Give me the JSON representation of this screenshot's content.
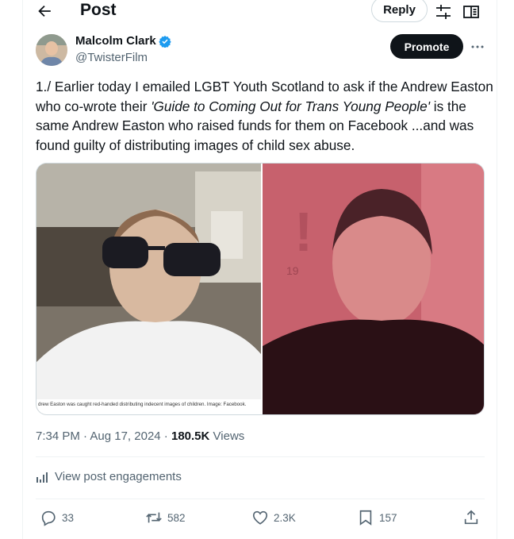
{
  "header": {
    "title": "Post",
    "reply_label": "Reply"
  },
  "author": {
    "name": "Malcolm Clark",
    "handle": "@TwisterFilm",
    "verified": true
  },
  "promote_label": "Promote",
  "post": {
    "text_part1": "1./ Earlier today I emailed LGBT Youth Scotland to ask if the Andrew Easton who co-wrote their ",
    "text_italic": "'Guide to Coming Out for Trans Young People'",
    "text_part2": " is the same Andrew Easton who raised funds for them on Facebook ...and was found guilty of distributing images of child sex abuse."
  },
  "media": {
    "left_caption": "drew Easton was caught red-handed distributing indecent images of children. Image: Facebook."
  },
  "meta": {
    "time": "7:34 PM",
    "date": "Aug 17, 2024",
    "views_count": "180.5K",
    "views_label": "Views"
  },
  "engagements_label": "View post engagements",
  "actions": {
    "replies": "33",
    "reposts": "582",
    "likes": "2.3K",
    "bookmarks": "157"
  },
  "colors": {
    "accent": "#1d9bf0",
    "text": "#0f1419",
    "secondary": "#536471"
  }
}
